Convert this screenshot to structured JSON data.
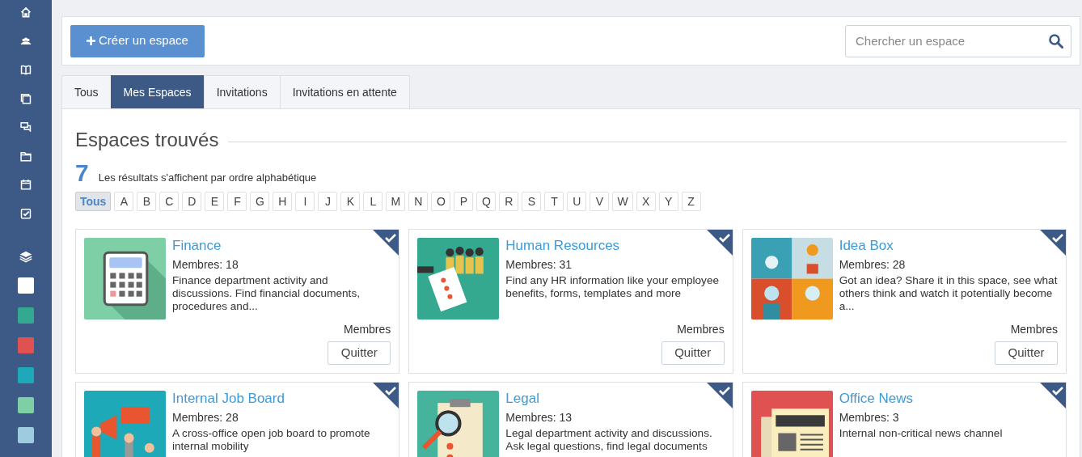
{
  "sidebar": {
    "spaces": [
      {
        "color": "#ffffff"
      },
      {
        "color": "#35a98f"
      },
      {
        "color": "#e05252"
      },
      {
        "color": "#1ea9b8"
      },
      {
        "color": "#7fcfa6"
      },
      {
        "color": "#9ecbe0"
      }
    ]
  },
  "toolbar": {
    "create_button": "Créer un espace",
    "search": {
      "placeholder": "Chercher un espace"
    }
  },
  "tabs": [
    {
      "label": "Tous",
      "selected": false
    },
    {
      "label": "Mes Espaces",
      "selected": true
    },
    {
      "label": "Invitations",
      "selected": false
    },
    {
      "label": "Invitations en attente",
      "selected": false
    }
  ],
  "heading": "Espaces trouvés",
  "result_count": "7",
  "result_note": "Les résultats s'affichent par ordre alphabétique",
  "letters": [
    {
      "label": "Tous",
      "selected": true
    },
    {
      "label": "A",
      "selected": false
    },
    {
      "label": "B",
      "selected": false
    },
    {
      "label": "C",
      "selected": false
    },
    {
      "label": "D",
      "selected": false
    },
    {
      "label": "E",
      "selected": false
    },
    {
      "label": "F",
      "selected": false
    },
    {
      "label": "G",
      "selected": false
    },
    {
      "label": "H",
      "selected": false
    },
    {
      "label": "I",
      "selected": false
    },
    {
      "label": "J",
      "selected": false
    },
    {
      "label": "K",
      "selected": false
    },
    {
      "label": "L",
      "selected": false
    },
    {
      "label": "M",
      "selected": false
    },
    {
      "label": "N",
      "selected": false
    },
    {
      "label": "O",
      "selected": false
    },
    {
      "label": "P",
      "selected": false
    },
    {
      "label": "Q",
      "selected": false
    },
    {
      "label": "R",
      "selected": false
    },
    {
      "label": "S",
      "selected": false
    },
    {
      "label": "T",
      "selected": false
    },
    {
      "label": "U",
      "selected": false
    },
    {
      "label": "V",
      "selected": false
    },
    {
      "label": "W",
      "selected": false
    },
    {
      "label": "X",
      "selected": false
    },
    {
      "label": "Y",
      "selected": false
    },
    {
      "label": "Z",
      "selected": false
    }
  ],
  "spaces": [
    {
      "kind": "calculator",
      "title": "Finance",
      "members": "Membres: 18",
      "description": "Finance department activity and discussions. Find financial documents, procedures and...",
      "role": "Membres",
      "button": "Quitter",
      "checked": true
    },
    {
      "kind": "team",
      "title": "Human Resources",
      "members": "Membres: 31",
      "description": "Find any HR information like your employee benefits, forms, templates and more",
      "role": "Membres",
      "button": "Quitter",
      "checked": true
    },
    {
      "kind": "ideas",
      "title": "Idea Box",
      "members": "Membres: 28",
      "description": "Got an idea? Share it in this space, see what others think and watch it potentially become a...",
      "role": "Membres",
      "button": "Quitter",
      "checked": true
    },
    {
      "kind": "job",
      "title": "Internal Job Board",
      "members": "Membres: 28",
      "description": "A cross-office open job board to promote internal mobility",
      "checked": true
    },
    {
      "kind": "legal",
      "title": "Legal",
      "members": "Membres: 13",
      "description": "Legal department activity and discussions. Ask legal questions, find legal documents",
      "checked": true
    },
    {
      "kind": "news",
      "title": "Office News",
      "members": "Membres: 3",
      "description": "Internal non-critical news channel",
      "checked": true
    }
  ]
}
